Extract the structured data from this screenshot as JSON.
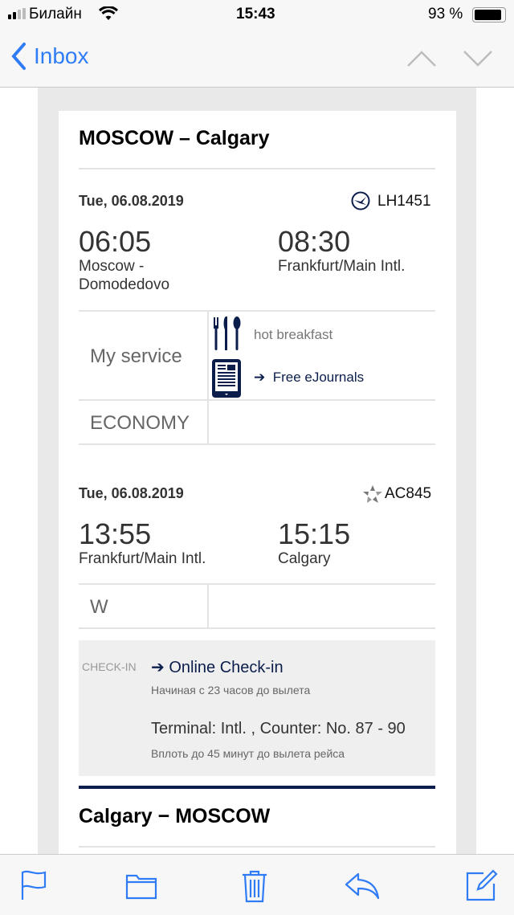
{
  "status_bar": {
    "carrier": "Билайн",
    "time": "15:43",
    "battery": "93 %",
    "battery_level": 0.93
  },
  "nav": {
    "back_label": "Inbox"
  },
  "colors": {
    "ios_blue": "#2f7cf6",
    "navy": "#0a1d4b"
  },
  "email": {
    "outbound_title": "MOSCOW – Calgary",
    "segments": [
      {
        "date": "Tue, 06.08.2019",
        "flight": "LH1451",
        "airline_icon": "lufthansa-crane-icon",
        "dep_time": "06:05",
        "dep_place": "Moscow - Domodedovo",
        "arr_time": "08:30",
        "arr_place": "Frankfurt/Main Intl.",
        "service_label": "My service",
        "meal": "hot breakfast",
        "ejournals": "Free eJournals",
        "cabin": "ECONOMY"
      },
      {
        "date": "Tue, 06.08.2019",
        "flight": "AC845",
        "airline_icon": "star-alliance-icon",
        "dep_time": "13:55",
        "dep_place": "Frankfurt/Main Intl.",
        "arr_time": "15:15",
        "arr_place": "Calgary",
        "cabin": "W"
      }
    ],
    "checkin": {
      "label": "CHECK-IN",
      "link": "Online Check-in",
      "online_note": "Начиная с 23 часов до вылета",
      "terminal": "Terminal: Intl. , Counter: No. 87 - 90",
      "counter_note": "Вплоть до 45 минут до вылета рейса"
    },
    "return_title": "Calgary − MOSCOW"
  },
  "toolbar": [
    "flag-icon",
    "folder-icon",
    "trash-icon",
    "reply-icon",
    "compose-icon"
  ]
}
